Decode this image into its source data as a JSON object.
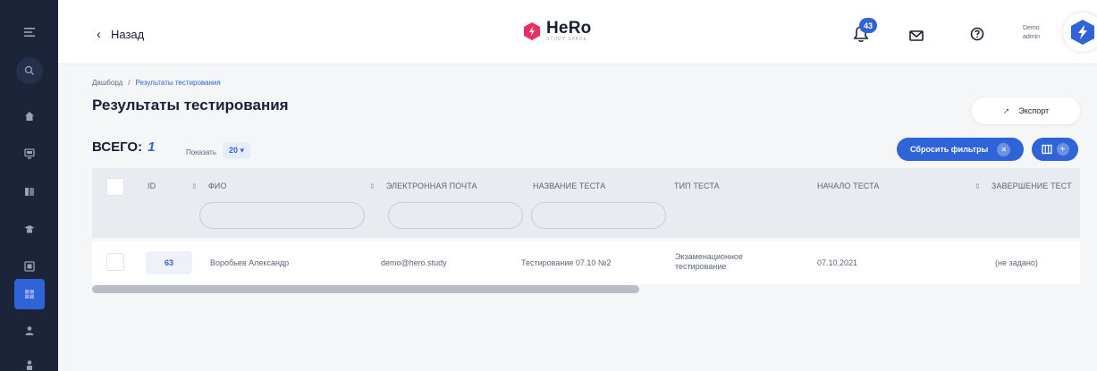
{
  "header": {
    "back_label": "Назад",
    "logo_name": "HeRo",
    "logo_sub": "STUDY SPACE",
    "notification_count": "43",
    "user_line1": "Demo",
    "user_line2": "admin"
  },
  "breadcrumb": {
    "root": "Дашборд",
    "separator": "/",
    "current": "Результаты тестирования"
  },
  "page": {
    "title": "Результаты тестирования",
    "export_label": "Экспорт",
    "total_label": "ВСЕГО:",
    "total_value": "1",
    "show_label": "Показать",
    "page_size": "20",
    "reset_filters_label": "Сбросить фильтры"
  },
  "table": {
    "columns": [
      "ID",
      "ФИО",
      "ЭЛЕКТРОННАЯ ПОЧТА",
      "НАЗВАНИЕ ТЕСТА",
      "ТИП ТЕСТА",
      "НАЧАЛО ТЕСТА",
      "ЗАВЕРШЕНИЕ ТЕСТ"
    ],
    "rows": [
      {
        "id": "63",
        "fio": "Воробьев Александр",
        "email": "demo@hero.study",
        "test_name": "Тестирование 07.10 №2",
        "test_type_line1": "Экзаменационное",
        "test_type_line2": "тестирование",
        "start": "07.10.2021",
        "end": "(не задано)"
      }
    ]
  },
  "colors": {
    "sidebar_bg": "#1b2439",
    "accent": "#2f63d8",
    "logo_accent": "#e8315f"
  }
}
